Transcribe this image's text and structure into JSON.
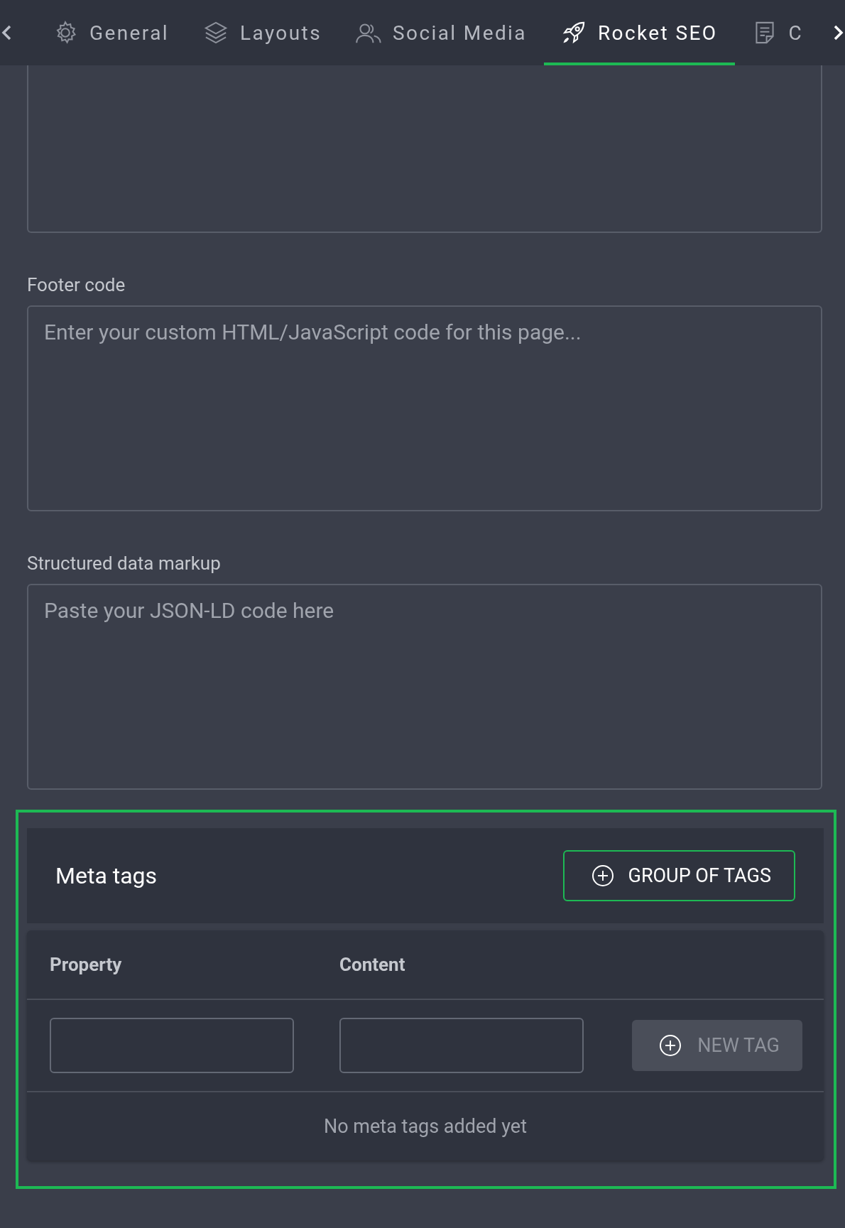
{
  "tabs": [
    {
      "label": "General",
      "selected": false
    },
    {
      "label": "Layouts",
      "selected": false
    },
    {
      "label": "Social Media",
      "selected": false
    },
    {
      "label": "Rocket SEO",
      "selected": true
    },
    {
      "label": "C",
      "selected": false
    }
  ],
  "fields": [
    {
      "label": "Footer code",
      "placeholder": "Enter your custom HTML/JavaScript code for this page..."
    },
    {
      "label": "Structured data markup",
      "placeholder": "Paste your JSON-LD code here"
    }
  ],
  "meta_tags": {
    "title": "Meta tags",
    "group_button": "GROUP OF TAGS",
    "columns": [
      "Property",
      "Content"
    ],
    "new_tag_button": {
      "label": "NEW TAG",
      "disabled": true
    },
    "empty_text": "No meta tags added yet"
  }
}
